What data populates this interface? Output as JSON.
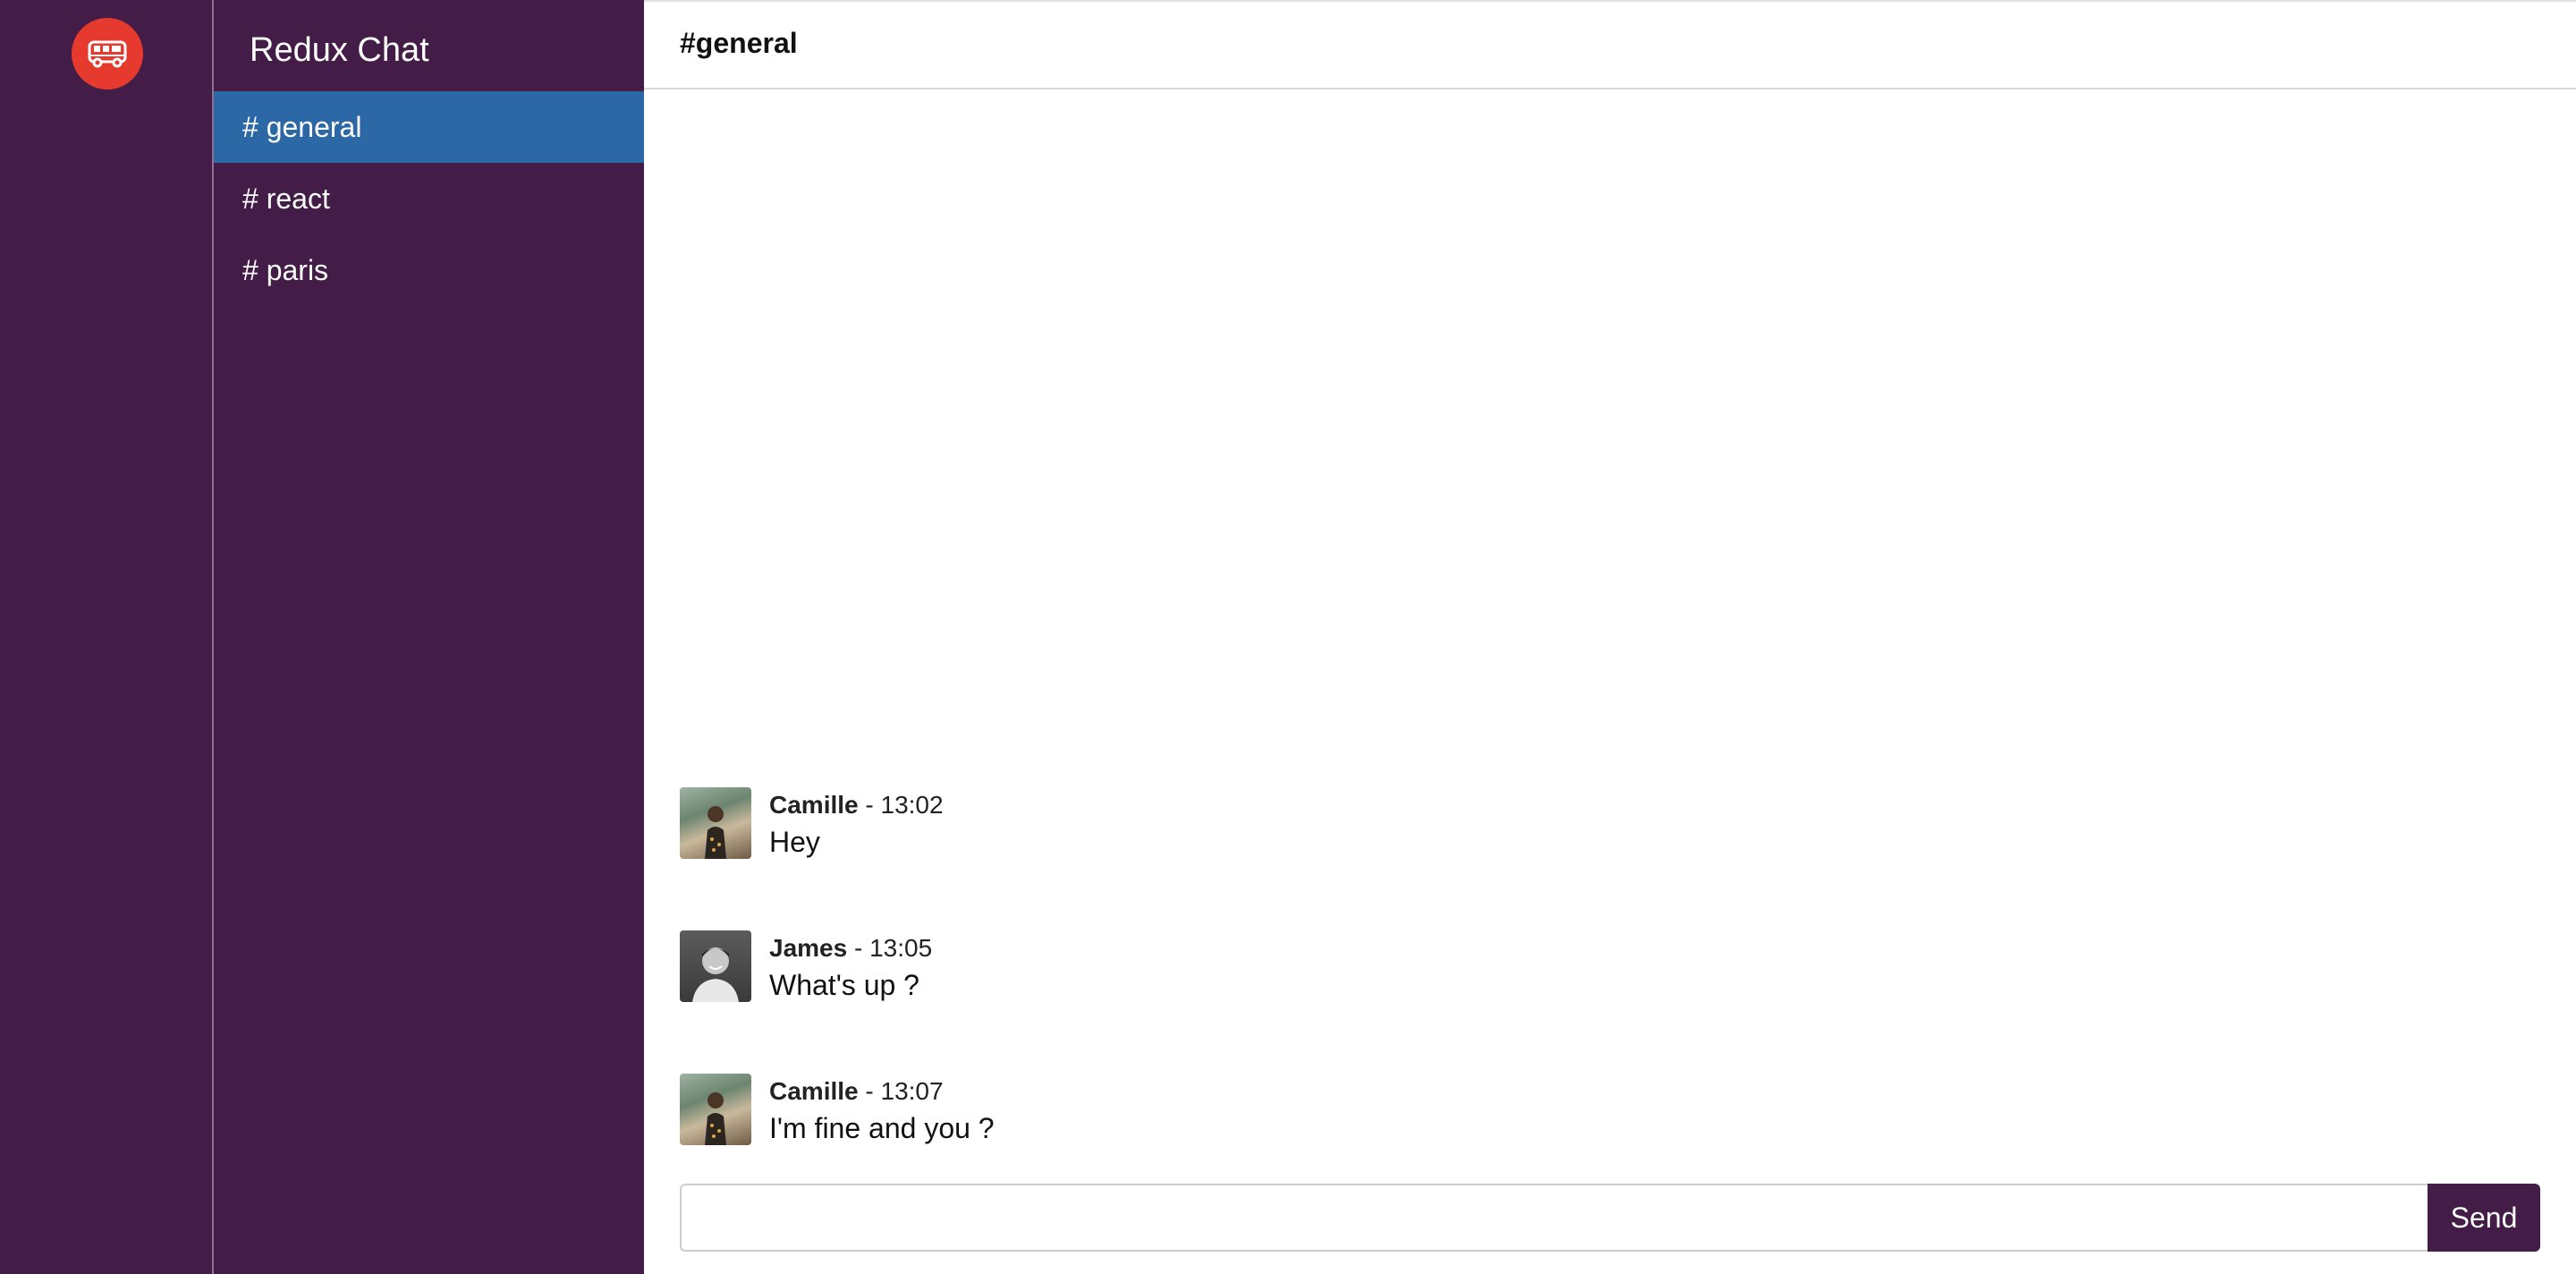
{
  "app": {
    "title": "Redux Chat",
    "logo_icon": "bus-icon",
    "logo_color": "#e63a2e",
    "sidebar_color": "#431c47",
    "active_color": "#2c67a6"
  },
  "channels": [
    {
      "label": "# general",
      "active": true
    },
    {
      "label": "# react",
      "active": false
    },
    {
      "label": "# paris",
      "active": false
    }
  ],
  "header": {
    "channel_title": "#general"
  },
  "messages": [
    {
      "author": "Camille",
      "time": " - 13:02",
      "text": "Hey",
      "avatar": "camille-avatar"
    },
    {
      "author": "James",
      "time": " - 13:05",
      "text": "What's up ?",
      "avatar": "james-avatar"
    },
    {
      "author": "Camille",
      "time": " - 13:07",
      "text": "I'm fine and you ?",
      "avatar": "camille-avatar"
    }
  ],
  "composer": {
    "value": "",
    "placeholder": "",
    "send_label": "Send"
  }
}
